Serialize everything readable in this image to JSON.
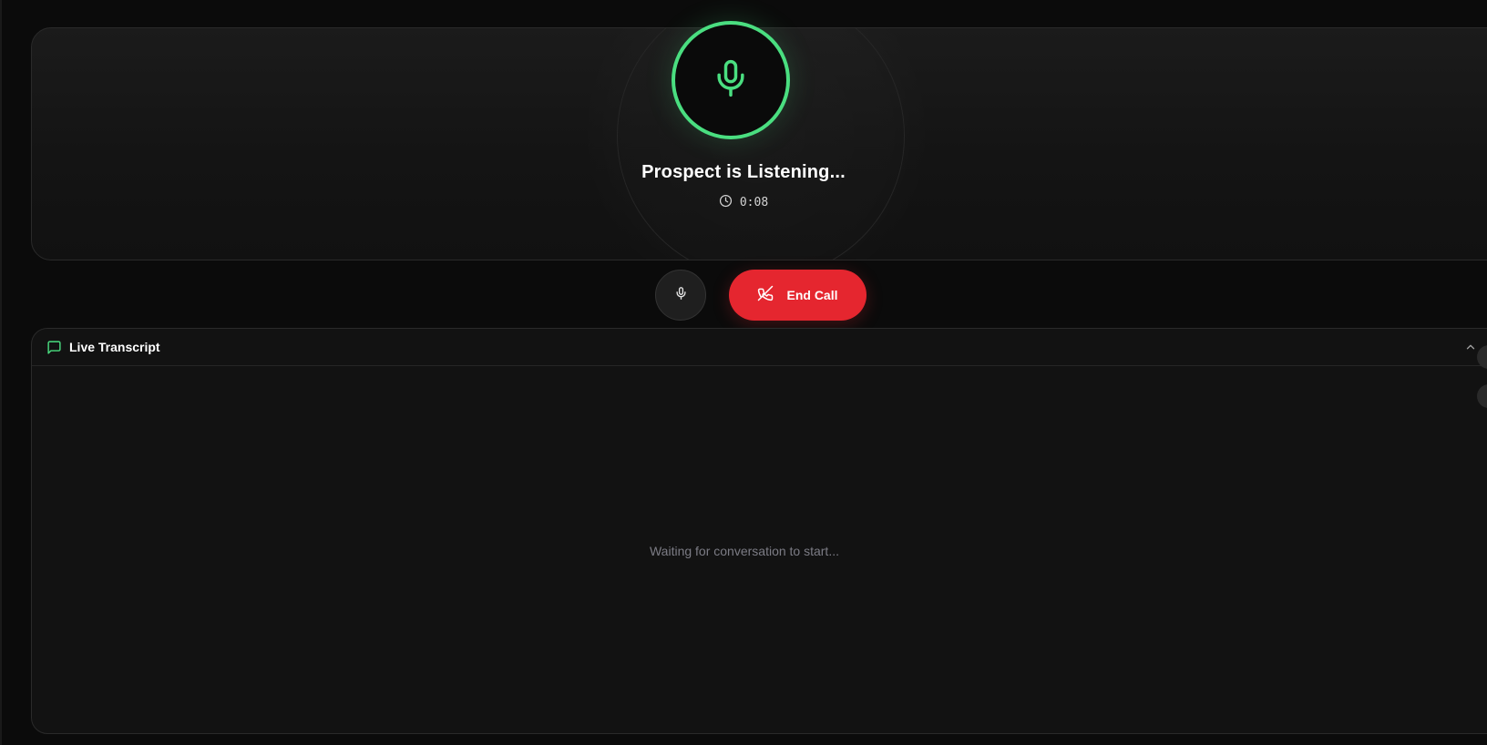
{
  "call": {
    "status_title": "Prospect is Listening...",
    "timer": "0:08",
    "mic_icon": "microphone-icon",
    "clock_icon": "clock-icon"
  },
  "controls": {
    "mute_icon": "microphone-icon",
    "end_call_label": "End Call",
    "end_call_icon": "phone-off-icon"
  },
  "transcript": {
    "title": "Live Transcript",
    "title_icon": "message-square-icon",
    "collapse_icon": "chevron-up-icon",
    "empty_message": "Waiting for conversation to start..."
  },
  "colors": {
    "accent_green": "#4ade80",
    "end_call_red": "#e5262f",
    "background": "#0b0b0b",
    "muted_text": "#7c7c85"
  }
}
